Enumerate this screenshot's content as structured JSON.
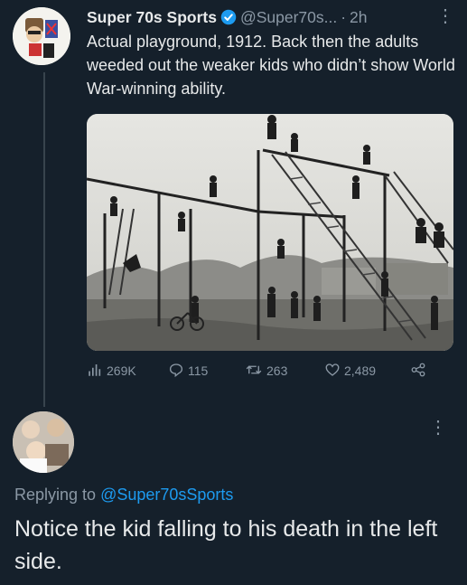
{
  "tweet": {
    "author_name": "Super 70s Sports",
    "handle": "@Super70s...",
    "separator": "·",
    "time": "2h",
    "text": "Actual playground, 1912. Back then the adults weeded out the weaker kids who didn’t show World War-winning ability.",
    "actions": {
      "views": "269K",
      "replies": "115",
      "retweets": "263",
      "likes": "2,489"
    }
  },
  "reply": {
    "replying_prefix": "Replying to ",
    "replying_mention": "@Super70sSports",
    "text": "Notice the kid falling to his death in the left side."
  },
  "icons": [
    "verified-badge-icon",
    "more-icon",
    "views-icon",
    "reply-icon",
    "retweet-icon",
    "like-icon",
    "share-icon"
  ],
  "colors": {
    "background": "#15202b",
    "accent": "#1d9bf0",
    "muted": "#8b98a5",
    "text": "#e7e9ea"
  }
}
